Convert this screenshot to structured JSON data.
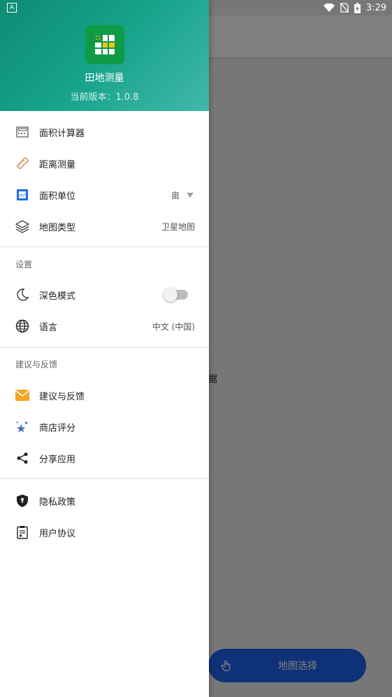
{
  "status_bar": {
    "time": "3:29",
    "badge": "A"
  },
  "background": {
    "partial_text": "据",
    "fab_label": "地图选择"
  },
  "drawer": {
    "header": {
      "app_name": "田地测量",
      "version": "当前版本：1.0.8"
    },
    "tools": [
      {
        "label": "面积计算器",
        "icon": "calculator-icon"
      },
      {
        "label": "距离测量",
        "icon": "ruler-icon"
      },
      {
        "label": "面积单位",
        "icon": "area-unit-icon",
        "value": "亩"
      },
      {
        "label": "地图类型",
        "icon": "layers-icon",
        "value": "卫星地图"
      }
    ],
    "settings": {
      "title": "设置",
      "dark_mode": {
        "label": "深色模式",
        "enabled": false
      },
      "language": {
        "label": "语言",
        "value": "中文 (中国)"
      }
    },
    "feedback": {
      "title": "建议与反馈",
      "items": [
        {
          "label": "建议与反馈",
          "icon": "envelope-icon"
        },
        {
          "label": "商店评分",
          "icon": "stars-icon"
        },
        {
          "label": "分享应用",
          "icon": "share-icon"
        }
      ]
    },
    "legal": [
      {
        "label": "隐私政策",
        "icon": "shield-icon"
      },
      {
        "label": "用户协议",
        "icon": "clipboard-icon"
      }
    ]
  },
  "colors": {
    "header_start": "#0f8b74",
    "header_end": "#41b8aa",
    "fab": "#1f63f0",
    "logo": "#0f9a46"
  }
}
